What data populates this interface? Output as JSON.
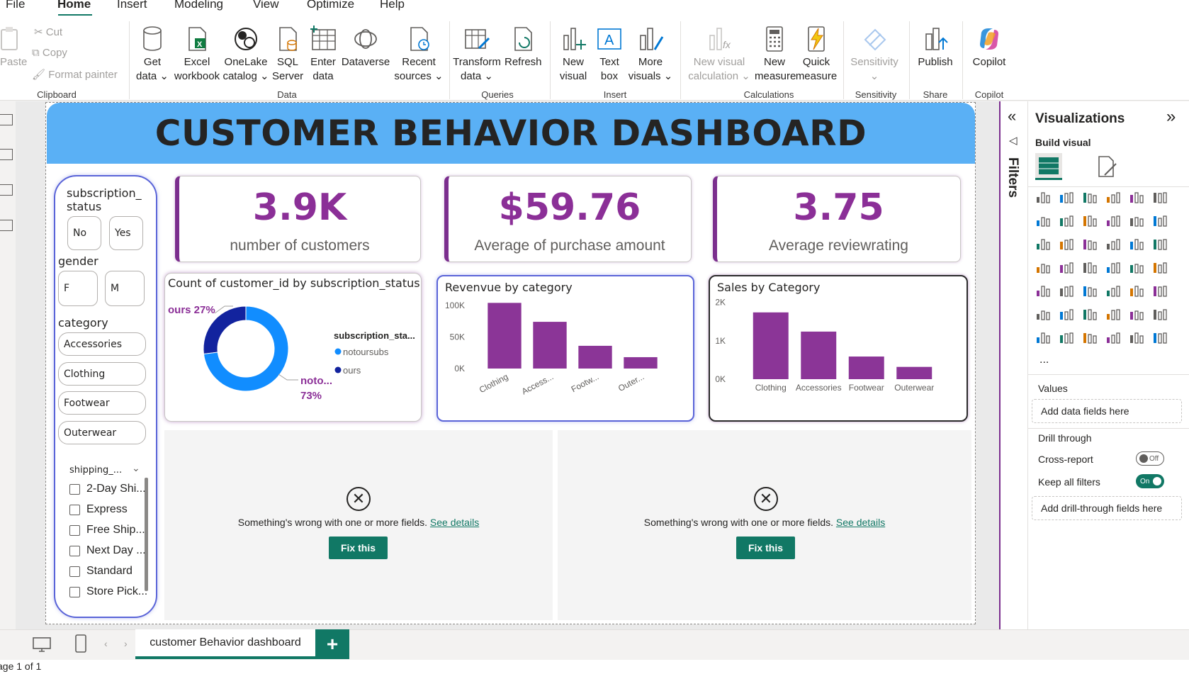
{
  "menu": {
    "file": "File",
    "home": "Home",
    "insert": "Insert",
    "modeling": "Modeling",
    "view": "View",
    "optimize": "Optimize",
    "help": "Help"
  },
  "ribbon": {
    "clipboard": {
      "paste": "Paste",
      "cut": "Cut",
      "copy": "Copy",
      "format_painter": "Format painter",
      "label": "Clipboard"
    },
    "data": {
      "get_data": [
        "Get",
        "data ⌄"
      ],
      "excel": [
        "Excel",
        "workbook"
      ],
      "onelake": [
        "OneLake",
        "catalog ⌄"
      ],
      "sql": [
        "SQL",
        "Server"
      ],
      "enter": [
        "Enter",
        "data"
      ],
      "dataverse": "Dataverse",
      "recent": [
        "Recent",
        "sources ⌄"
      ],
      "label": "Data"
    },
    "queries": {
      "transform": [
        "Transform",
        "data ⌄"
      ],
      "refresh": "Refresh",
      "label": "Queries"
    },
    "insert": {
      "new_visual": [
        "New",
        "visual"
      ],
      "text_box": [
        "Text",
        "box"
      ],
      "more_visuals": [
        "More",
        "visuals ⌄"
      ],
      "label": "Insert"
    },
    "calculations": {
      "new_visual_calc": [
        "New visual",
        "calculation ⌄"
      ],
      "new_measure": [
        "New",
        "measure"
      ],
      "quick_measure": [
        "Quick",
        "measure"
      ],
      "label": "Calculations"
    },
    "sensitivity": {
      "button": [
        "Sensitivity",
        "⌄"
      ],
      "label": "Sensitivity"
    },
    "share": {
      "publish": "Publish",
      "label": "Share"
    },
    "copilot": {
      "button": "Copilot",
      "label": "Copilot"
    }
  },
  "dashboard": {
    "title": "CUSTOMER BEHAVIOR DASHBOARD",
    "accent": "#8b2f97",
    "header_color": "#5ab0f5"
  },
  "slicers": {
    "subscription_label": [
      "subscription_",
      "status"
    ],
    "subscription_options": [
      "No",
      "Yes"
    ],
    "gender_label": "gender",
    "gender_options": [
      "F",
      "M"
    ],
    "category_label": "category",
    "category_options": [
      "Accessories",
      "Clothing",
      "Footwear",
      "Outerwear"
    ],
    "shipping_label": "shipping_...",
    "shipping_options": [
      "2-Day Shi...",
      "Express",
      "Free Ship...",
      "Next Day ...",
      "Standard",
      "Store Pick..."
    ]
  },
  "kpis": [
    {
      "value": "3.9K",
      "label": "number of customers"
    },
    {
      "value": "$59.76",
      "label": "Average of purchase amount"
    },
    {
      "value": "3.75",
      "label": "Average reviewrating"
    }
  ],
  "chart_data": [
    {
      "type": "pie",
      "donut": true,
      "title": "Count of customer_id by subscription_status",
      "legend_title": "subscription_sta...",
      "legend_position": "right",
      "series": [
        {
          "name": "notoursubs",
          "value": 73,
          "color": "#118dff",
          "label": "noto...",
          "pct": "73%"
        },
        {
          "name": "ours",
          "value": 27,
          "color": "#12239e",
          "label": "ours 27%"
        }
      ]
    },
    {
      "type": "bar",
      "title": "Revenvue by category",
      "categories": [
        "Clothing",
        "Access...",
        "Footw...",
        "Outer..."
      ],
      "values": [
        104000,
        74000,
        36000,
        18000
      ],
      "yticks": [
        "100K",
        "50K",
        "0K"
      ],
      "ytick_values": [
        100000,
        50000,
        0
      ],
      "ylim": [
        0,
        110000
      ],
      "color": "#8b3597"
    },
    {
      "type": "bar",
      "title": "Sales by Category",
      "categories": [
        "Clothing",
        "Accessories",
        "Footwear",
        "Outerwear"
      ],
      "values": [
        1740,
        1240,
        590,
        320
      ],
      "yticks": [
        "2K",
        "1K",
        "0K"
      ],
      "ytick_values": [
        2000,
        1000,
        0
      ],
      "ylim": [
        0,
        2050
      ],
      "color": "#8b3597"
    }
  ],
  "errors": [
    {
      "message": "Something's wrong with one or more fields.",
      "link": "See details",
      "button": "Fix this"
    },
    {
      "message": "Something's wrong with one or more fields.",
      "link": "See details",
      "button": "Fix this"
    }
  ],
  "filters": {
    "label": "Filters"
  },
  "viz_pane": {
    "title": "Visualizations",
    "build_visual": "Build visual",
    "more": "...",
    "values_label": "Values",
    "values_placeholder": "Add data fields here",
    "drill_through": "Drill through",
    "cross_report": "Cross-report",
    "cross_report_state": "Off",
    "keep_filters": "Keep all filters",
    "keep_filters_state": "On",
    "drill_placeholder": "Add drill-through fields here"
  },
  "bottom": {
    "page_tab": "customer Behavior dashboard",
    "add_page": "+",
    "status": "age 1 of 1"
  }
}
